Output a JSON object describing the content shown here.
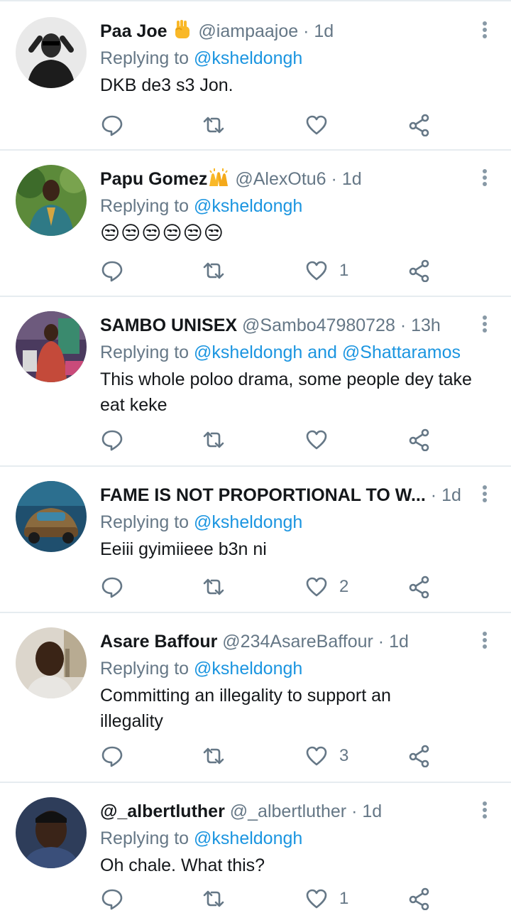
{
  "colors": {
    "link": "#1b95e0",
    "muted": "#657786",
    "text": "#14171a",
    "divider": "#e6ecf0"
  },
  "icons": {
    "reply": "reply-icon",
    "retweet": "retweet-icon",
    "like": "heart-icon",
    "share": "share-icon",
    "more": "more-vertical-icon"
  },
  "tweets": [
    {
      "name": "Paa Joe",
      "name_emoji": "raised-fist",
      "handle": "@iampaajoe",
      "sep": "·",
      "time": "1d",
      "reply_prefix": "Replying to",
      "mentions": "@ksheldongh",
      "text": "DKB de3 s3 Jon.",
      "emoji_text": "",
      "likes": ""
    },
    {
      "name": "Papu Gomez",
      "name_emoji": "raising-hands",
      "handle": "@AlexOtu6",
      "sep": "·",
      "time": "1d",
      "reply_prefix": "Replying to",
      "mentions": "@ksheldongh",
      "text": "",
      "emoji_text": "😒😒😒😒😒😒",
      "likes": "1"
    },
    {
      "name": "SAMBO UNISEX",
      "name_emoji": "",
      "handle": "@Sambo47980728",
      "sep": "·",
      "time": "13h",
      "reply_prefix": "Replying to",
      "mentions": "@ksheldongh and @Shattaramos",
      "text": "This whole poloo drama, some people dey take eat keke",
      "emoji_text": "",
      "likes": ""
    },
    {
      "name": "FAME IS NOT PROPORTIONAL TO W...",
      "name_emoji": "",
      "handle": "",
      "sep": "·",
      "time": "1d",
      "reply_prefix": "Replying to",
      "mentions": "@ksheldongh",
      "text": "Eeiii gyimiieee b3n ni",
      "emoji_text": "",
      "likes": "2"
    },
    {
      "name": "Asare Baffour",
      "name_emoji": "",
      "handle": "@234AsareBaffour",
      "sep": "·",
      "time": "1d",
      "reply_prefix": "Replying to",
      "mentions": "@ksheldongh",
      "text": "Committing an illegality to support an illegality",
      "emoji_text": "",
      "likes": "3"
    },
    {
      "name": "@_albertluther",
      "name_emoji": "",
      "handle": "@_albertluther",
      "sep": "·",
      "time": "1d",
      "reply_prefix": "Replying to",
      "mentions": "@ksheldongh",
      "text": "Oh chale. What this?",
      "emoji_text": "",
      "likes": "1"
    }
  ]
}
